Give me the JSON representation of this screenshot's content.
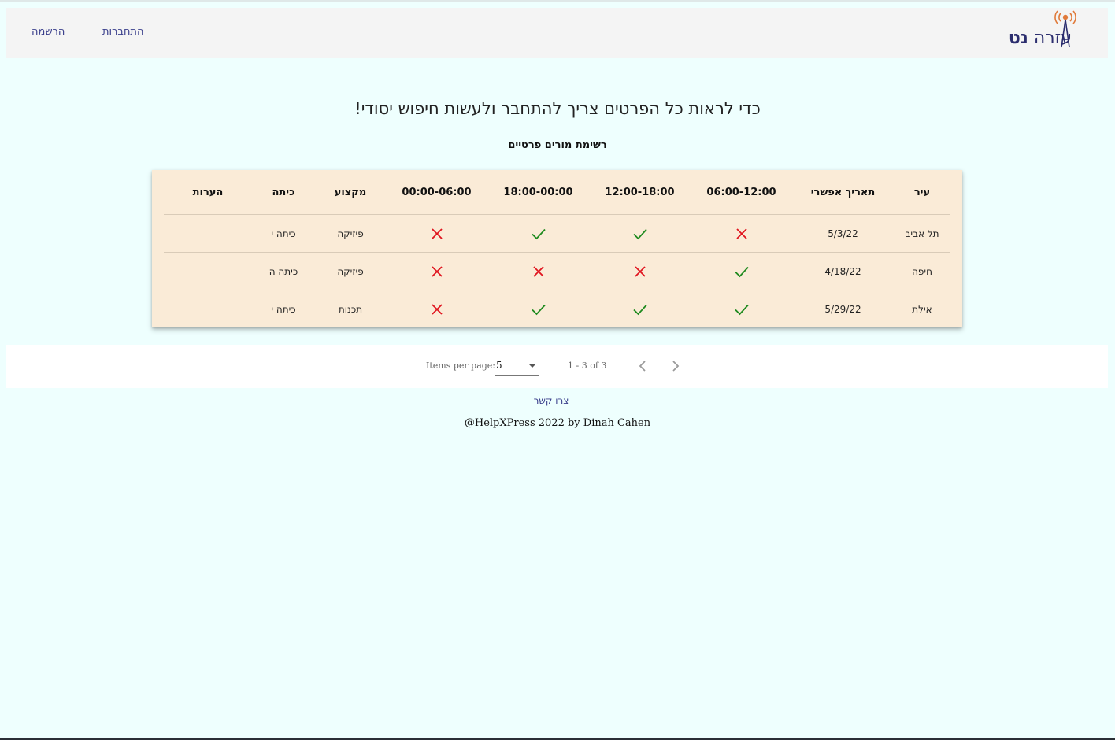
{
  "header": {
    "logo_text_light": "עזרה",
    "logo_text_bold": "נט",
    "nav_login": "התחברות",
    "nav_register": "הרשמה"
  },
  "main": {
    "heading": "כדי לראות כל הפרטים צריך להתחבר ולעשות חיפוש יסודי!",
    "subheading": "רשימת מורים פרטיים"
  },
  "table": {
    "columns": [
      "עיר",
      "תאריך אפשרי",
      "06:00-12:00",
      "12:00-18:00",
      "18:00-00:00",
      "00:00-06:00",
      "מקצוע",
      "כיתה",
      "הערות"
    ],
    "rows": [
      {
        "city": "תל אביב",
        "date": "5/3/22",
        "slots": [
          false,
          true,
          true,
          false
        ],
        "subject": "פיזיקה",
        "grade": "כיתה י",
        "notes": ""
      },
      {
        "city": "חיפה",
        "date": "4/18/22",
        "slots": [
          true,
          false,
          false,
          false
        ],
        "subject": "פיזיקה",
        "grade": "כיתה ה",
        "notes": ""
      },
      {
        "city": "אילת",
        "date": "5/29/22",
        "slots": [
          true,
          true,
          true,
          false
        ],
        "subject": "תכנות",
        "grade": "כיתה י",
        "notes": ""
      }
    ],
    "check_icon": "check-icon",
    "cross_icon": "close-icon",
    "check_color": "#1e8a1e",
    "cross_color": "#e0141e"
  },
  "paginator": {
    "items_per_page_label": "Items per page:",
    "page_size": "5",
    "range_label": "1 - 3 of 3"
  },
  "footer": {
    "contact": "צרו קשר",
    "copyright": "@HelpXPress 2022 by Dinah Cahen"
  },
  "colors": {
    "background": "#eefffe",
    "header_bg": "#f4f4f4",
    "table_bg": "#faebd7",
    "link": "#3a3f8c",
    "logo_text": "#2b2d6e",
    "logo_antenna": "#e07a3a"
  }
}
